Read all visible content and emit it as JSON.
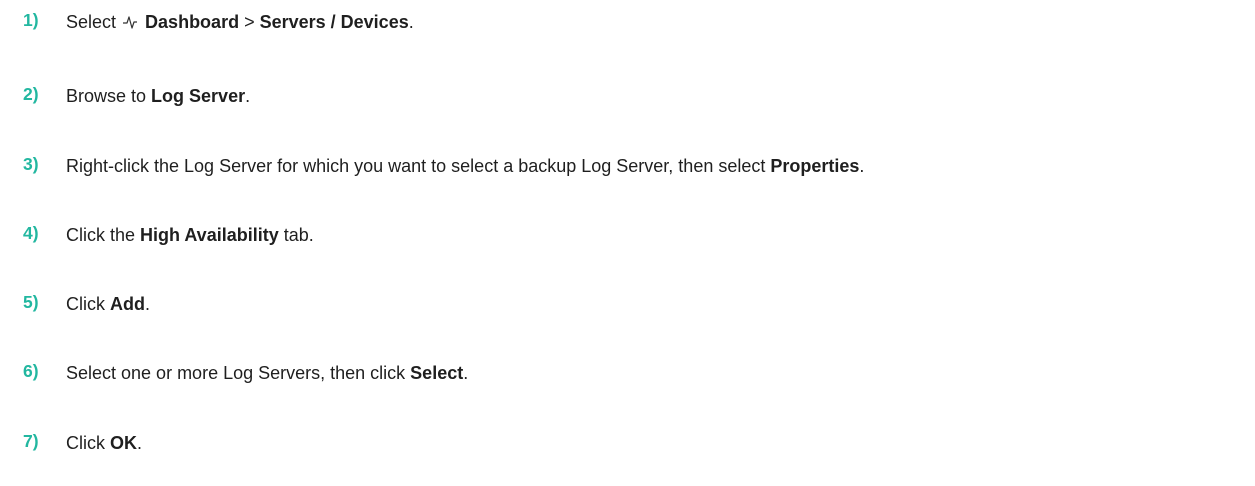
{
  "steps": [
    {
      "number": "1)",
      "parts": [
        {
          "t": "Select "
        },
        {
          "icon": "dashboard-icon"
        },
        {
          "t": " "
        },
        {
          "t": "Dashboard",
          "b": true
        },
        {
          "t": " > "
        },
        {
          "t": "Servers / Devices",
          "b": true
        },
        {
          "t": "."
        }
      ]
    },
    {
      "number": "2)",
      "parts": [
        {
          "t": "Browse to "
        },
        {
          "t": "Log Server",
          "b": true
        },
        {
          "t": "."
        }
      ]
    },
    {
      "number": "3)",
      "parts": [
        {
          "t": "Right-click the Log Server for which you want to select a backup Log Server, then select "
        },
        {
          "t": "Properties",
          "b": true
        },
        {
          "t": "."
        }
      ]
    },
    {
      "number": "4)",
      "parts": [
        {
          "t": "Click the "
        },
        {
          "t": "High Availability",
          "b": true
        },
        {
          "t": " tab."
        }
      ]
    },
    {
      "number": "5)",
      "parts": [
        {
          "t": "Click "
        },
        {
          "t": "Add",
          "b": true
        },
        {
          "t": "."
        }
      ]
    },
    {
      "number": "6)",
      "parts": [
        {
          "t": "Select one or more Log Servers, then click "
        },
        {
          "t": "Select",
          "b": true
        },
        {
          "t": "."
        }
      ]
    },
    {
      "number": "7)",
      "parts": [
        {
          "t": "Click "
        },
        {
          "t": "OK",
          "b": true
        },
        {
          "t": "."
        }
      ]
    }
  ],
  "colors": {
    "step_number": "#22b7a0",
    "text": "#1f1f1f"
  }
}
